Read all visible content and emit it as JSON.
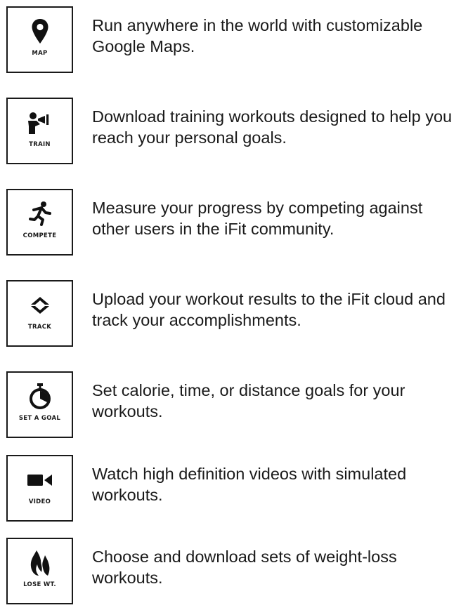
{
  "features": [
    {
      "icon": "map-pin-icon",
      "label": "MAP",
      "description": "Run anywhere in the world with customizable Google Maps."
    },
    {
      "icon": "trainer-megaphone-icon",
      "label": "TRAIN",
      "description": "Download training workouts designed to help you reach your personal goals."
    },
    {
      "icon": "runner-icon",
      "label": "COMPETE",
      "description": "Measure your progress by competing against other users in the iFit community."
    },
    {
      "icon": "sync-arrows-icon",
      "label": "TRACK",
      "description": "Upload your workout results to the iFit cloud and track your accomplishments."
    },
    {
      "icon": "stopwatch-icon",
      "label": "SET A GOAL",
      "description": "Set calorie, time, or distance goals for your workouts."
    },
    {
      "icon": "video-camera-icon",
      "label": "VIDEO",
      "description": "Watch high definition videos with simulated workouts."
    },
    {
      "icon": "flame-icon",
      "label": "LOSE WT.",
      "description": "Choose and download sets of weight-loss workouts."
    }
  ]
}
